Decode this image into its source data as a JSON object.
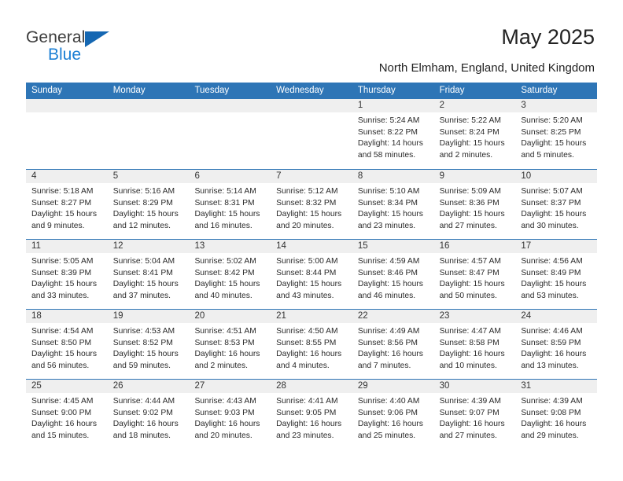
{
  "brand": {
    "name_top": "General",
    "name_bottom": "Blue",
    "triangle_color": "#1567b2",
    "blue_text_color": "#1b7fd4"
  },
  "header": {
    "title": "May 2025",
    "subtitle": "North Elmham, England, United Kingdom"
  },
  "calendar": {
    "header_bg": "#2e75b6",
    "day_band_bg": "#efefef",
    "weekdays": [
      "Sunday",
      "Monday",
      "Tuesday",
      "Wednesday",
      "Thursday",
      "Friday",
      "Saturday"
    ],
    "weeks": [
      [
        {
          "day": "",
          "lines": []
        },
        {
          "day": "",
          "lines": []
        },
        {
          "day": "",
          "lines": []
        },
        {
          "day": "",
          "lines": []
        },
        {
          "day": "1",
          "lines": [
            "Sunrise: 5:24 AM",
            "Sunset: 8:22 PM",
            "Daylight: 14 hours",
            "and 58 minutes."
          ]
        },
        {
          "day": "2",
          "lines": [
            "Sunrise: 5:22 AM",
            "Sunset: 8:24 PM",
            "Daylight: 15 hours",
            "and 2 minutes."
          ]
        },
        {
          "day": "3",
          "lines": [
            "Sunrise: 5:20 AM",
            "Sunset: 8:25 PM",
            "Daylight: 15 hours",
            "and 5 minutes."
          ]
        }
      ],
      [
        {
          "day": "4",
          "lines": [
            "Sunrise: 5:18 AM",
            "Sunset: 8:27 PM",
            "Daylight: 15 hours",
            "and 9 minutes."
          ]
        },
        {
          "day": "5",
          "lines": [
            "Sunrise: 5:16 AM",
            "Sunset: 8:29 PM",
            "Daylight: 15 hours",
            "and 12 minutes."
          ]
        },
        {
          "day": "6",
          "lines": [
            "Sunrise: 5:14 AM",
            "Sunset: 8:31 PM",
            "Daylight: 15 hours",
            "and 16 minutes."
          ]
        },
        {
          "day": "7",
          "lines": [
            "Sunrise: 5:12 AM",
            "Sunset: 8:32 PM",
            "Daylight: 15 hours",
            "and 20 minutes."
          ]
        },
        {
          "day": "8",
          "lines": [
            "Sunrise: 5:10 AM",
            "Sunset: 8:34 PM",
            "Daylight: 15 hours",
            "and 23 minutes."
          ]
        },
        {
          "day": "9",
          "lines": [
            "Sunrise: 5:09 AM",
            "Sunset: 8:36 PM",
            "Daylight: 15 hours",
            "and 27 minutes."
          ]
        },
        {
          "day": "10",
          "lines": [
            "Sunrise: 5:07 AM",
            "Sunset: 8:37 PM",
            "Daylight: 15 hours",
            "and 30 minutes."
          ]
        }
      ],
      [
        {
          "day": "11",
          "lines": [
            "Sunrise: 5:05 AM",
            "Sunset: 8:39 PM",
            "Daylight: 15 hours",
            "and 33 minutes."
          ]
        },
        {
          "day": "12",
          "lines": [
            "Sunrise: 5:04 AM",
            "Sunset: 8:41 PM",
            "Daylight: 15 hours",
            "and 37 minutes."
          ]
        },
        {
          "day": "13",
          "lines": [
            "Sunrise: 5:02 AM",
            "Sunset: 8:42 PM",
            "Daylight: 15 hours",
            "and 40 minutes."
          ]
        },
        {
          "day": "14",
          "lines": [
            "Sunrise: 5:00 AM",
            "Sunset: 8:44 PM",
            "Daylight: 15 hours",
            "and 43 minutes."
          ]
        },
        {
          "day": "15",
          "lines": [
            "Sunrise: 4:59 AM",
            "Sunset: 8:46 PM",
            "Daylight: 15 hours",
            "and 46 minutes."
          ]
        },
        {
          "day": "16",
          "lines": [
            "Sunrise: 4:57 AM",
            "Sunset: 8:47 PM",
            "Daylight: 15 hours",
            "and 50 minutes."
          ]
        },
        {
          "day": "17",
          "lines": [
            "Sunrise: 4:56 AM",
            "Sunset: 8:49 PM",
            "Daylight: 15 hours",
            "and 53 minutes."
          ]
        }
      ],
      [
        {
          "day": "18",
          "lines": [
            "Sunrise: 4:54 AM",
            "Sunset: 8:50 PM",
            "Daylight: 15 hours",
            "and 56 minutes."
          ]
        },
        {
          "day": "19",
          "lines": [
            "Sunrise: 4:53 AM",
            "Sunset: 8:52 PM",
            "Daylight: 15 hours",
            "and 59 minutes."
          ]
        },
        {
          "day": "20",
          "lines": [
            "Sunrise: 4:51 AM",
            "Sunset: 8:53 PM",
            "Daylight: 16 hours",
            "and 2 minutes."
          ]
        },
        {
          "day": "21",
          "lines": [
            "Sunrise: 4:50 AM",
            "Sunset: 8:55 PM",
            "Daylight: 16 hours",
            "and 4 minutes."
          ]
        },
        {
          "day": "22",
          "lines": [
            "Sunrise: 4:49 AM",
            "Sunset: 8:56 PM",
            "Daylight: 16 hours",
            "and 7 minutes."
          ]
        },
        {
          "day": "23",
          "lines": [
            "Sunrise: 4:47 AM",
            "Sunset: 8:58 PM",
            "Daylight: 16 hours",
            "and 10 minutes."
          ]
        },
        {
          "day": "24",
          "lines": [
            "Sunrise: 4:46 AM",
            "Sunset: 8:59 PM",
            "Daylight: 16 hours",
            "and 13 minutes."
          ]
        }
      ],
      [
        {
          "day": "25",
          "lines": [
            "Sunrise: 4:45 AM",
            "Sunset: 9:00 PM",
            "Daylight: 16 hours",
            "and 15 minutes."
          ]
        },
        {
          "day": "26",
          "lines": [
            "Sunrise: 4:44 AM",
            "Sunset: 9:02 PM",
            "Daylight: 16 hours",
            "and 18 minutes."
          ]
        },
        {
          "day": "27",
          "lines": [
            "Sunrise: 4:43 AM",
            "Sunset: 9:03 PM",
            "Daylight: 16 hours",
            "and 20 minutes."
          ]
        },
        {
          "day": "28",
          "lines": [
            "Sunrise: 4:41 AM",
            "Sunset: 9:05 PM",
            "Daylight: 16 hours",
            "and 23 minutes."
          ]
        },
        {
          "day": "29",
          "lines": [
            "Sunrise: 4:40 AM",
            "Sunset: 9:06 PM",
            "Daylight: 16 hours",
            "and 25 minutes."
          ]
        },
        {
          "day": "30",
          "lines": [
            "Sunrise: 4:39 AM",
            "Sunset: 9:07 PM",
            "Daylight: 16 hours",
            "and 27 minutes."
          ]
        },
        {
          "day": "31",
          "lines": [
            "Sunrise: 4:39 AM",
            "Sunset: 9:08 PM",
            "Daylight: 16 hours",
            "and 29 minutes."
          ]
        }
      ]
    ]
  }
}
